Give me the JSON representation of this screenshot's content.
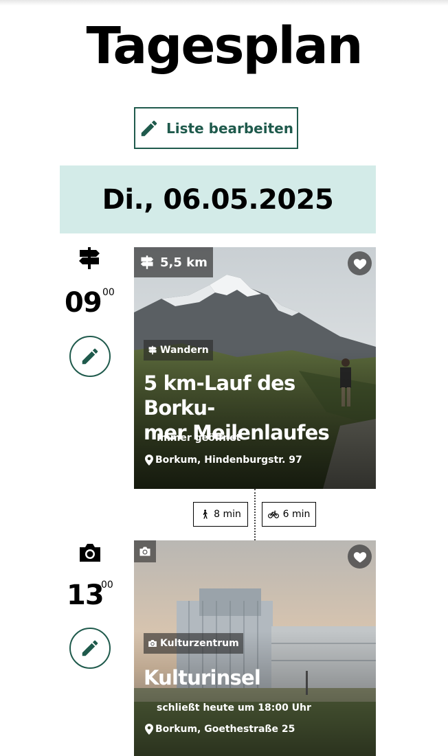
{
  "page": {
    "title": "Tagesplan"
  },
  "toolbar": {
    "edit_list_label": "Liste bearbeiten"
  },
  "day": {
    "date": "Di., 06.05.2025"
  },
  "entries": [
    {
      "type_icon": "signpost-icon",
      "hour": "09",
      "minute": "00",
      "distance": "5,5 km",
      "category": "Wandern",
      "title_line1": "5 km-Lauf des Borku-",
      "title_line2": "mer Meilenlaufes",
      "status": "Immer geöffnet",
      "address": "Borkum, Hindenburgstr. 97"
    },
    {
      "type_icon": "camera-icon",
      "hour": "13",
      "minute": "00",
      "category": "Kulturzentrum",
      "title": "Kulturinsel",
      "status": "schließt heute um 18:00 Uhr",
      "address": "Borkum, Goethestraße 25"
    }
  ],
  "travel": {
    "walk": "8 min",
    "bike": "6 min"
  },
  "colors": {
    "accent": "#1f5a4c",
    "date_bg": "#d3ebe8"
  }
}
